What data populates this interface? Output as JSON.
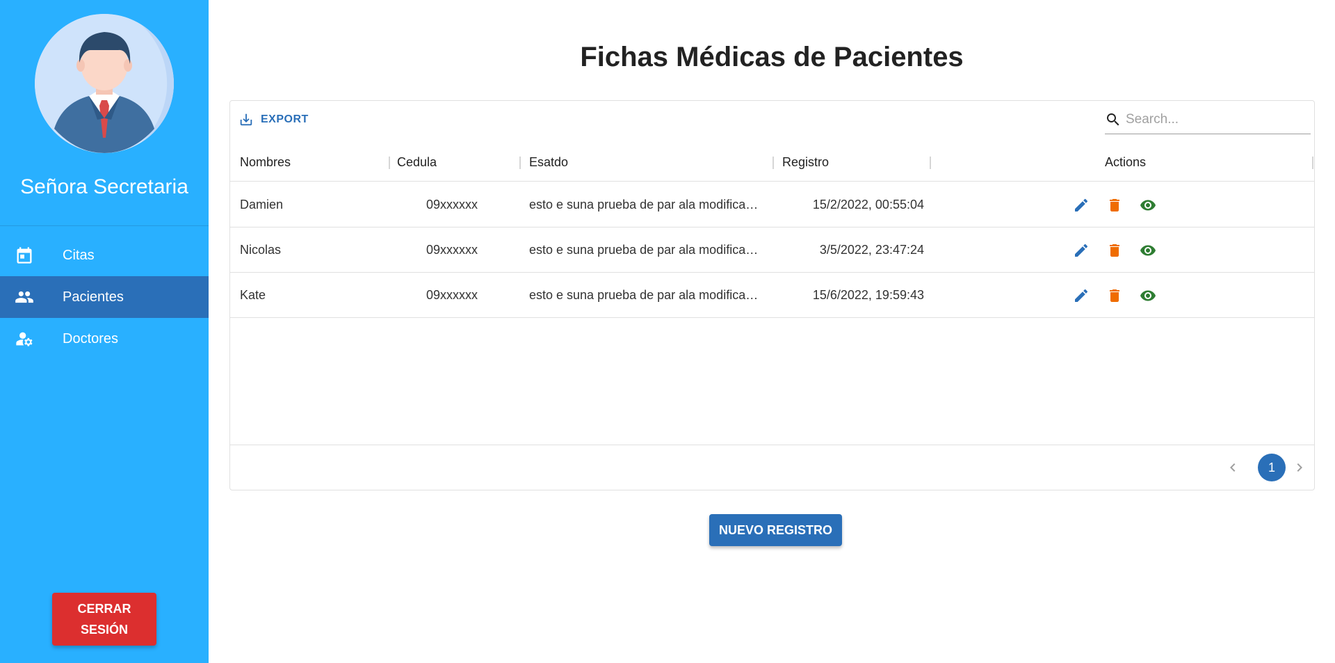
{
  "sidebar": {
    "user_name": "Señora Secretaria",
    "items": [
      {
        "label": "Citas",
        "icon": "calendar-icon",
        "active": false
      },
      {
        "label": "Pacientes",
        "icon": "people-icon",
        "active": true
      },
      {
        "label": "Doctores",
        "icon": "person-gear-icon",
        "active": false
      }
    ],
    "logout_line1": "CERRAR",
    "logout_line2": "SESIÓN",
    "color": "#29b0ff",
    "active_color": "#2a6fb8"
  },
  "main": {
    "title": "Fichas Médicas de Pacientes",
    "toolbar": {
      "export_label": "EXPORT",
      "search_placeholder": "Search..."
    },
    "columns": [
      "Nombres",
      "Cedula",
      "Esatdo",
      "Registro",
      "Actions"
    ],
    "rows": [
      {
        "nombre": "Damien",
        "cedula": "09xxxxxx",
        "estado": "esto e suna prueba de par ala modificación",
        "registro": "15/2/2022, 00:55:04"
      },
      {
        "nombre": "Nicolas",
        "cedula": "09xxxxxx",
        "estado": "esto e suna prueba de par ala modificación",
        "registro": "3/5/2022, 23:47:24"
      },
      {
        "nombre": "Kate",
        "cedula": "09xxxxxx",
        "estado": "esto e suna prueba de par ala modificación",
        "registro": "15/6/2022, 19:59:43"
      }
    ],
    "pagination": {
      "current_page": "1"
    },
    "new_button_label": "NUEVO REGISTRO",
    "colors": {
      "edit": "#2a6fb8",
      "delete": "#ef6c00",
      "view": "#2e7d32",
      "primary": "#2a6fb8",
      "danger": "#dc2f2f"
    }
  }
}
